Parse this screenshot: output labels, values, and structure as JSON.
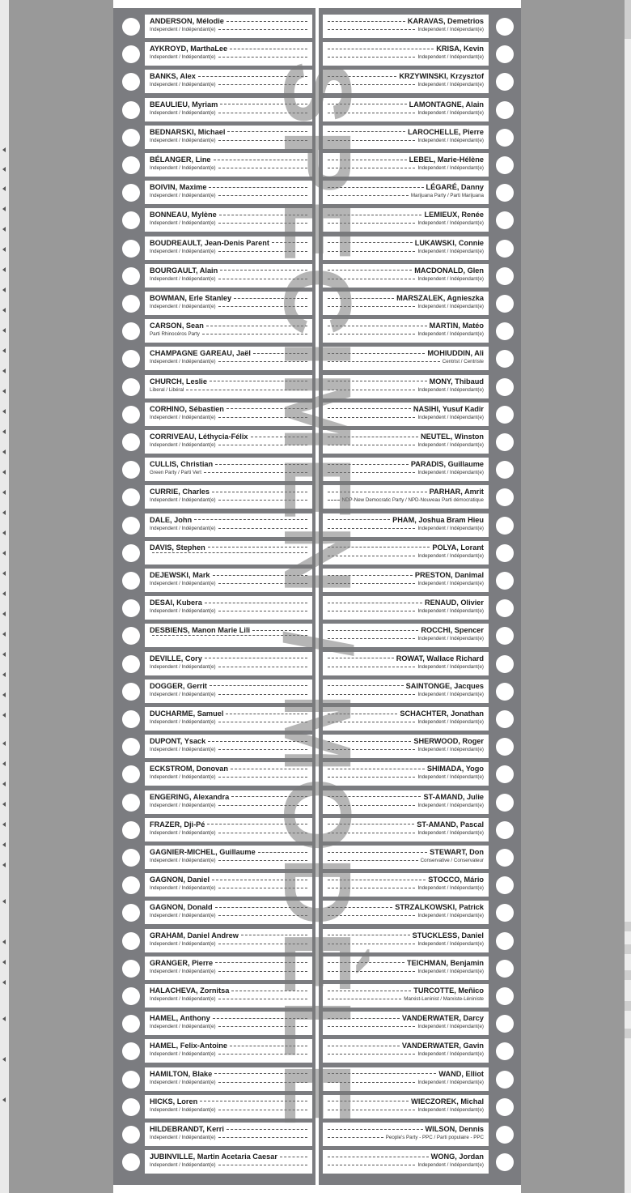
{
  "watermark": "SPECIMEN / MODÈLE",
  "columns": [
    {
      "side": "left",
      "candidates": [
        {
          "name": "ANDERSON, Mélodie",
          "party": "Independent / Indépendant(e)"
        },
        {
          "name": "AYKROYD, MarthaLee",
          "party": "Independent / Indépendant(e)"
        },
        {
          "name": "BANKS, Alex",
          "party": "Independent / Indépendant(e)"
        },
        {
          "name": "BEAULIEU, Myriam",
          "party": "Independent / Indépendant(e)"
        },
        {
          "name": "BEDNARSKI, Michael",
          "party": "Independent / Indépendant(e)"
        },
        {
          "name": "BÉLANGER, Line",
          "party": "Independent / Indépendant(e)"
        },
        {
          "name": "BOIVIN, Maxime",
          "party": "Independent / Indépendant(e)"
        },
        {
          "name": "BONNEAU, Mylène",
          "party": "Independent / Indépendant(e)"
        },
        {
          "name": "BOUDREAULT, Jean-Denis Parent",
          "party": "Independent / Indépendant(e)"
        },
        {
          "name": "BOURGAULT, Alain",
          "party": "Independent / Indépendant(e)"
        },
        {
          "name": "BOWMAN, Erle Stanley",
          "party": "Independent / Indépendant(e)"
        },
        {
          "name": "CARSON, Sean",
          "party": "Parti Rhinocéros Party"
        },
        {
          "name": "CHAMPAGNE GAREAU, Jaël",
          "party": "Independent / Indépendant(e)"
        },
        {
          "name": "CHURCH, Leslie",
          "party": "Liberal / Libéral"
        },
        {
          "name": "CORHINO, Sébastien",
          "party": "Independent / Indépendant(e)"
        },
        {
          "name": "CORRIVEAU, Léthycia-Félix",
          "party": "Independent / Indépendant(e)"
        },
        {
          "name": "CULLIS, Christian",
          "party": "Green Party / Parti Vert"
        },
        {
          "name": "CURRIE, Charles",
          "party": "Independent / Indépendant(e)"
        },
        {
          "name": "DALE, John",
          "party": "Independent / Indépendant(e)"
        },
        {
          "name": "DAVIS, Stephen",
          "party": ""
        },
        {
          "name": "DEJEWSKI, Mark",
          "party": "Independent / Indépendant(e)"
        },
        {
          "name": "DESAI, Kubera",
          "party": "Independent / Indépendant(e)"
        },
        {
          "name": "DESBIENS, Manon Marie Lili",
          "party": ""
        },
        {
          "name": "DEVILLE, Cory",
          "party": "Independent / Indépendant(e)"
        },
        {
          "name": "DOGGER, Gerrit",
          "party": "Independent / Indépendant(e)"
        },
        {
          "name": "DUCHARME, Samuel",
          "party": "Independent / Indépendant(e)"
        },
        {
          "name": "DUPONT, Ysack",
          "party": "Independent / Indépendant(e)"
        },
        {
          "name": "ECKSTROM, Donovan",
          "party": "Independent / Indépendant(e)"
        },
        {
          "name": "ENGERING, Alexandra",
          "party": "Independent / Indépendant(e)"
        },
        {
          "name": "FRAZER, Dji-Pé",
          "party": "Independent / Indépendant(e)"
        },
        {
          "name": "GAGNIER-MICHEL, Guillaume",
          "party": "Independent / Indépendant(e)"
        },
        {
          "name": "GAGNON, Daniel",
          "party": "Independent / Indépendant(e)"
        },
        {
          "name": "GAGNON, Donald",
          "party": "Independent / Indépendant(e)"
        },
        {
          "name": "GRAHAM, Daniel Andrew",
          "party": "Independent / Indépendant(e)"
        },
        {
          "name": "GRANGER, Pierre",
          "party": "Independent / Indépendant(e)"
        },
        {
          "name": "HALACHEVA, Zornitsa",
          "party": "Independent / Indépendant(e)"
        },
        {
          "name": "HAMEL, Anthony",
          "party": "Independent / Indépendant(e)"
        },
        {
          "name": "HAMEL, Felix-Antoine",
          "party": "Independent / Indépendant(e)"
        },
        {
          "name": "HAMILTON, Blake",
          "party": "Independent / Indépendant(e)"
        },
        {
          "name": "HICKS, Loren",
          "party": "Independent / Indépendant(e)"
        },
        {
          "name": "HILDEBRANDT, Kerri",
          "party": "Independent / Indépendant(e)"
        },
        {
          "name": "JUBINVILLE, Martin Acetaria Caesar",
          "party": "Independent / Indépendant(e)"
        }
      ]
    },
    {
      "side": "right",
      "candidates": [
        {
          "name": "KARAVAS, Demetrios",
          "party": "Independent / Indépendant(e)"
        },
        {
          "name": "KRISA, Kevin",
          "party": "Independent / Indépendant(e)"
        },
        {
          "name": "KRZYWINSKI, Krzysztof",
          "party": "Independent / Indépendant(e)"
        },
        {
          "name": "LAMONTAGNE, Alain",
          "party": "Independent / Indépendant(e)"
        },
        {
          "name": "LAROCHELLE, Pierre",
          "party": "Independent / Indépendant(e)"
        },
        {
          "name": "LEBEL, Marie-Hélène",
          "party": "Independent / Indépendant(e)"
        },
        {
          "name": "LÉGARÉ, Danny",
          "party": "Marijuana Party / Parti Marijuana"
        },
        {
          "name": "LEMIEUX, Renée",
          "party": "Independent / Indépendant(e)"
        },
        {
          "name": "LUKAWSKI, Connie",
          "party": "Independent / Indépendant(e)"
        },
        {
          "name": "MACDONALD, Glen",
          "party": "Independent / Indépendant(e)"
        },
        {
          "name": "MARSZALEK, Agnieszka",
          "party": "Independent / Indépendant(e)"
        },
        {
          "name": "MARTIN, Matéo",
          "party": "Independent / Indépendant(e)"
        },
        {
          "name": "MOHIUDDIN, Ali",
          "party": "Centrist / Centriste"
        },
        {
          "name": "MONY, Thibaud",
          "party": "Independent / Indépendant(e)"
        },
        {
          "name": "NASIHI, Yusuf Kadir",
          "party": "Independent / Indépendant(e)"
        },
        {
          "name": "NEUTEL, Winston",
          "party": "Independent / Indépendant(e)"
        },
        {
          "name": "PARADIS, Guillaume",
          "party": "Independent / Indépendant(e)"
        },
        {
          "name": "PARHAR, Amrit",
          "party": "NDP-New Democratic Party / NPD-Nouveau Parti démocratique"
        },
        {
          "name": "PHAM, Joshua Bram Hieu",
          "party": "Independent / Indépendant(e)"
        },
        {
          "name": "POLYA, Lorant",
          "party": "Independent / Indépendant(e)"
        },
        {
          "name": "PRESTON, Danimal",
          "party": "Independent / Indépendant(e)"
        },
        {
          "name": "RENAUD, Olivier",
          "party": "Independent / Indépendant(e)"
        },
        {
          "name": "ROCCHI, Spencer",
          "party": "Independent / Indépendant(e)"
        },
        {
          "name": "ROWAT, Wallace Richard",
          "party": "Independent / Indépendant(e)"
        },
        {
          "name": "SAINTONGE, Jacques",
          "party": "Independent / Indépendant(e)"
        },
        {
          "name": "SCHACHTER, Jonathan",
          "party": "Independent / Indépendant(e)"
        },
        {
          "name": "SHERWOOD, Roger",
          "party": "Independent / Indépendant(e)"
        },
        {
          "name": "SHIMADA, Yogo",
          "party": "Independent / Indépendant(e)"
        },
        {
          "name": "ST-AMAND, Julie",
          "party": "Independent / Indépendant(e)"
        },
        {
          "name": "ST-AMAND, Pascal",
          "party": "Independent / Indépendant(e)"
        },
        {
          "name": "STEWART, Don",
          "party": "Conservative / Conservateur"
        },
        {
          "name": "STOCCO, Mário",
          "party": "Independent / Indépendant(e)"
        },
        {
          "name": "STRZALKOWSKI, Patrick",
          "party": "Independent / Indépendant(e)"
        },
        {
          "name": "STUCKLESS, Daniel",
          "party": "Independent / Indépendant(e)"
        },
        {
          "name": "TEICHMAN, Benjamin",
          "party": "Independent / Indépendant(e)"
        },
        {
          "name": "TURCOTTE, Meñico",
          "party": "Marxist-Leninist / Marxiste-Léniniste"
        },
        {
          "name": "VANDERWATER, Darcy",
          "party": "Independent / Indépendant(e)"
        },
        {
          "name": "VANDERWATER, Gavin",
          "party": "Independent / Indépendant(e)"
        },
        {
          "name": "WAND, Elliot",
          "party": "Independent / Indépendant(e)"
        },
        {
          "name": "WIECZOREK, Michal",
          "party": "Independent / Indépendant(e)"
        },
        {
          "name": "WILSON, Dennis",
          "party": "People's Party - PPC / Parti populaire - PPC"
        },
        {
          "name": "WONG, Jordan",
          "party": "Independent / Indépendant(e)"
        }
      ]
    }
  ]
}
